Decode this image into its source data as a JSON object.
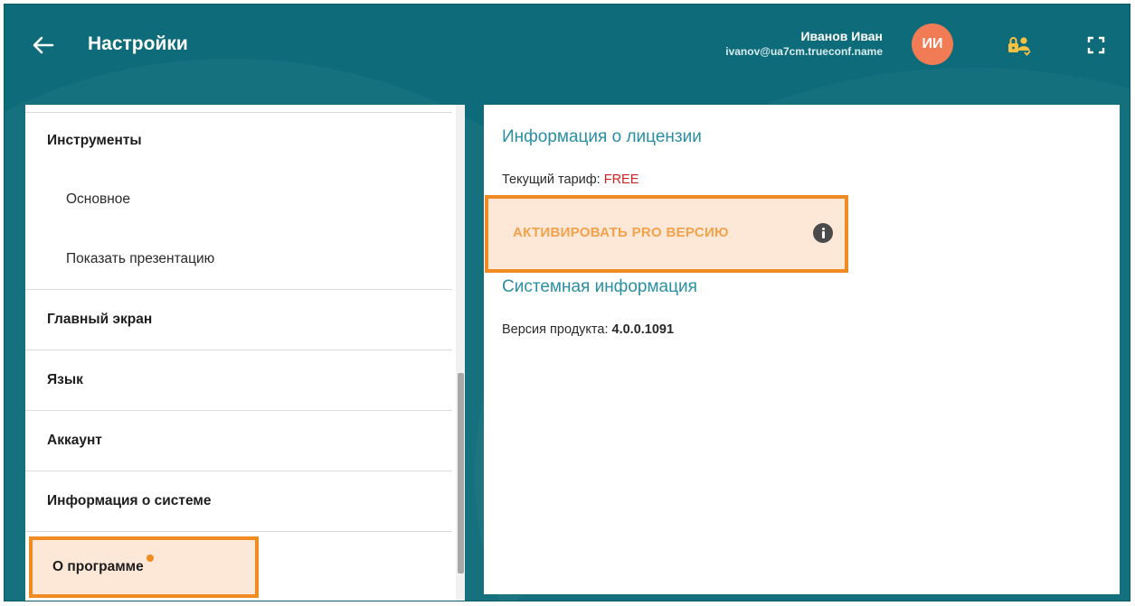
{
  "header": {
    "title": "Настройки",
    "back_icon": "arrow-left-icon",
    "user_name": "Иванов Иван",
    "user_email": "ivanov@ua7cm.trueconf.name",
    "avatar_initials": "ИИ",
    "license_icon": "lock-user-icon",
    "fullscreen_icon": "fullscreen-icon"
  },
  "sidebar": {
    "items": [
      {
        "label": "Инструменты",
        "type": "section"
      },
      {
        "label": "Основное",
        "type": "sub"
      },
      {
        "label": "Показать презентацию",
        "type": "sub"
      },
      {
        "label": "Главный экран",
        "type": "section"
      },
      {
        "label": "Язык",
        "type": "section"
      },
      {
        "label": "Аккаунт",
        "type": "section"
      },
      {
        "label": "Информация о системе",
        "type": "section"
      },
      {
        "label": "О программе",
        "type": "section",
        "active": true,
        "has_notification_dot": true
      }
    ]
  },
  "content": {
    "license_title": "Информация о лицензии",
    "tariff_label": "Текущий тариф:",
    "tariff_value": "FREE",
    "activate_button": "АКТИВИРОВАТЬ PRO ВЕРСИЮ",
    "info_icon": "info-icon",
    "system_title": "Системная информация",
    "version_label": "Версия продукта:",
    "version_value": "4.0.0.1091"
  },
  "colors": {
    "background_teal": "#0e6c7a",
    "accent_orange": "#f08a22",
    "highlight_fill": "#fde8d8",
    "avatar": "#f07b55",
    "section_title": "#2a8fa3",
    "free_red": "#cc2222"
  }
}
